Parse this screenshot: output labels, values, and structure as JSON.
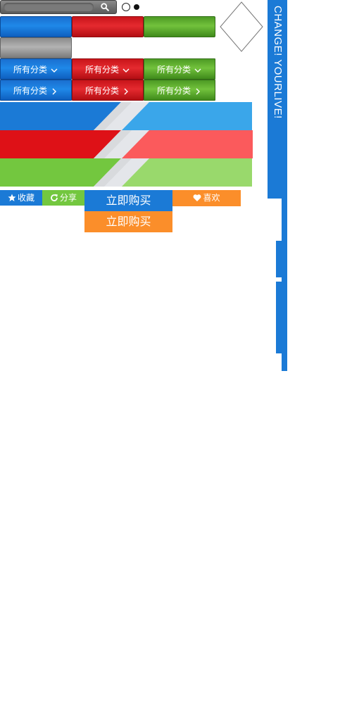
{
  "search": {
    "placeholder": "",
    "icon": "search-icon"
  },
  "radios": [
    {
      "state": "unselected"
    },
    {
      "state": "selected"
    }
  ],
  "color_buttons": [
    {
      "color": "#1f88e8",
      "name": "blue"
    },
    {
      "color": "#e52a2f",
      "name": "red"
    },
    {
      "color": "#72c23c",
      "name": "green"
    },
    {
      "color": "#b3b3b3",
      "name": "gray"
    }
  ],
  "categories": {
    "dropdown_row": [
      {
        "label": "所有分类",
        "icon": "chevron-down-icon",
        "color": "#1f88e8"
      },
      {
        "label": "所有分类",
        "icon": "chevron-down-icon",
        "color": "#e52a2f"
      },
      {
        "label": "所有分类",
        "icon": "chevron-down-icon",
        "color": "#72c23c"
      }
    ],
    "arrow_row": [
      {
        "label": "所有分类",
        "icon": "chevron-right-icon",
        "color": "#1f88e8"
      },
      {
        "label": "所有分类",
        "icon": "chevron-right-icon",
        "color": "#e52a2f"
      },
      {
        "label": "所有分类",
        "icon": "chevron-right-icon",
        "color": "#72c23c"
      }
    ]
  },
  "banners": [
    {
      "name": "blue",
      "dark": "#1b7ad6",
      "light": "#3aa6ea"
    },
    {
      "name": "red",
      "dark": "#de1117",
      "light": "#fb5a5c"
    },
    {
      "name": "green",
      "dark": "#73c73f",
      "light": "#99d96c"
    }
  ],
  "actions": {
    "favorite": {
      "label": "收藏",
      "icon": "star-icon",
      "color": "#1b7ad6"
    },
    "share": {
      "label": "分享",
      "icon": "refresh-icon",
      "color": "#73c73f"
    },
    "buy_now": {
      "label": "立即购买",
      "color": "#1b7ad6"
    },
    "buy_now_alt": {
      "label": "立即购买",
      "color": "#fb8e2a"
    },
    "like": {
      "label": "喜欢",
      "icon": "heart-icon",
      "color": "#fb8e2a"
    }
  },
  "sidebar": {
    "text": "CHANGE! YOURLIVE!",
    "color": "#1b7ad6"
  }
}
